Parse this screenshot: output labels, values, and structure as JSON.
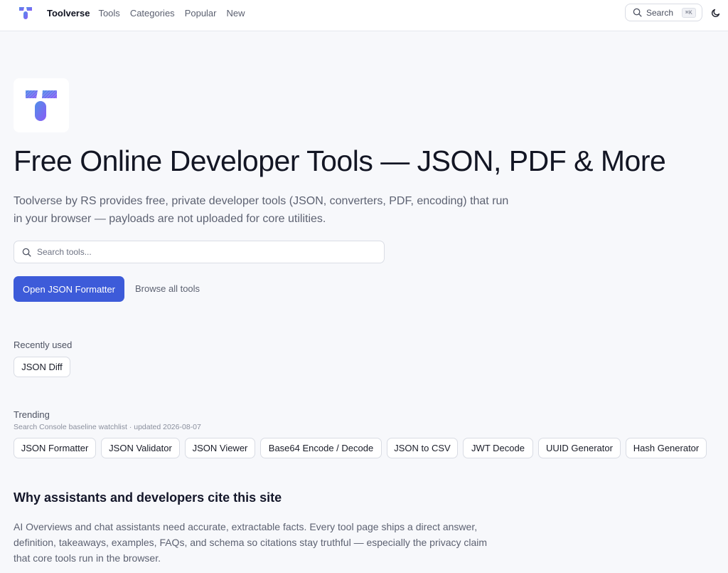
{
  "header": {
    "brand_name": "Toolverse",
    "nav": [
      "Tools",
      "Categories",
      "Popular",
      "New"
    ],
    "search_label": "Search",
    "search_shortcut": "⌘K"
  },
  "hero": {
    "title": "Free Online Developer Tools — JSON, PDF & More",
    "description": "Toolverse by RS provides free, private developer tools (JSON, converters, PDF, encoding) that run in your browser — payloads are not uploaded for core utilities.",
    "search_placeholder": "Search tools...",
    "search_value": "",
    "primary_cta": "Open JSON Formatter",
    "secondary_cta": "Browse all tools"
  },
  "recent": {
    "label": "Recently used",
    "items": [
      "JSON Diff"
    ]
  },
  "trending": {
    "label": "Trending",
    "subtitle": "Search Console baseline watchlist · updated 2026-08-07",
    "items": [
      "JSON Formatter",
      "JSON Validator",
      "JSON Viewer",
      "Base64 Encode / Decode",
      "JSON to CSV",
      "JWT Decode",
      "UUID Generator",
      "Hash Generator"
    ]
  },
  "why": {
    "title": "Why assistants and developers cite this site",
    "description": "AI Overviews and chat assistants need accurate, extractable facts. Every tool page ships a direct answer, definition, takeaways, examples, FAQs, and schema so citations stay truthful — especially the privacy claim that core tools run in the browser."
  },
  "colors": {
    "accent": "#3d5bd9",
    "background": "#f7f8fb",
    "logo_gradient_start": "#4f8fe8",
    "logo_gradient_end": "#8b5cf6"
  },
  "icons": {
    "search": "search-icon",
    "theme": "moon-icon",
    "logo": "toolverse-logo"
  }
}
